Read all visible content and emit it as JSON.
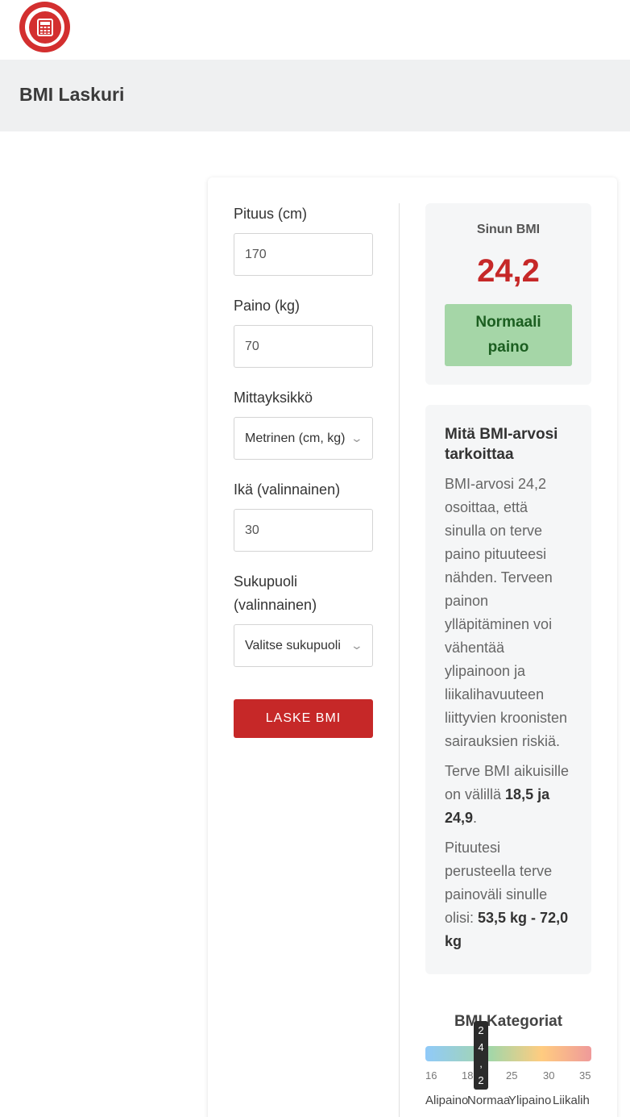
{
  "header": {
    "logo_icon": "calculator-icon",
    "title": "BMI Laskuri"
  },
  "form": {
    "height_label": "Pituus (cm)",
    "height_value": "170",
    "weight_label": "Paino (kg)",
    "weight_value": "70",
    "unit_label": "Mittayksikkö",
    "unit_value": "Metrinen (cm, kg)",
    "age_label": "Ikä (valinnainen)",
    "age_value": "30",
    "gender_label_line1": "Sukupuoli",
    "gender_label_line2": "(valinnainen)",
    "gender_value": "Valitse sukupuoli",
    "submit_label": "LASKE BMI"
  },
  "result": {
    "label": "Sinun BMI",
    "value": "24,2",
    "category_line1": "Normaali",
    "category_line2": "paino",
    "category_color": "#a5d6a7",
    "value_color": "#c62828"
  },
  "info": {
    "title": "Mitä BMI-arvosi tarkoittaa",
    "p1": "BMI-arvosi 24,2 osoittaa, että sinulla on terve paino pituuteesi nähden. Terveen painon ylläpitäminen voi vähentää ylipainoon ja liikalihavuuteen liittyvien kroonisten sairauksien riskiä.",
    "p2_text": "Terve BMI aikuisille on välillä ",
    "p2_bold": "18,5 ja 24,9",
    "p2_end": ".",
    "p3_text": "Pituutesi perusteella terve paino­väli sinulle olisi: ",
    "p3_bold": "53,5 kg - 72,0 kg"
  },
  "categories": {
    "title": "BMI Kategoriat",
    "marker_chars": [
      "2",
      "4",
      ",",
      "2"
    ],
    "ticks": [
      "16",
      "18",
      "25",
      "30",
      "35"
    ],
    "names": [
      "Alipaino",
      "Normaa",
      "Ylipaino",
      "Liikalih"
    ]
  }
}
